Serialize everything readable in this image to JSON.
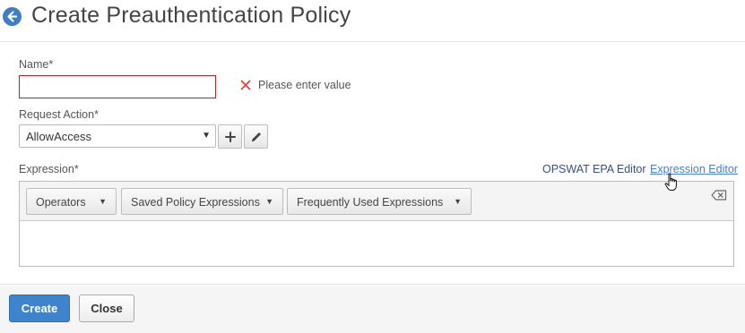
{
  "header": {
    "title": "Create Preauthentication Policy"
  },
  "form": {
    "name": {
      "label": "Name*",
      "value": "",
      "error": "Please enter value"
    },
    "request_action": {
      "label": "Request Action*",
      "selected": "AllowAccess",
      "caret": "▼"
    },
    "expression": {
      "label": "Expression*",
      "links": {
        "opswat": "OPSWAT EPA Editor",
        "expression_editor": "Expression Editor"
      },
      "toolbar": {
        "operators": "Operators",
        "saved": "Saved Policy Expressions",
        "frequent": "Frequently Used Expressions",
        "caret": "▼"
      },
      "value": ""
    }
  },
  "footer": {
    "create_label": "Create",
    "close_label": "Close"
  },
  "colors": {
    "accent": "#3d84cc",
    "error": "#d9141b",
    "link": "#4a7fc1"
  },
  "icons": [
    "back-arrow-icon",
    "error-x-icon",
    "plus-icon",
    "pencil-icon",
    "clear-backspace-icon",
    "hand-cursor-icon"
  ]
}
